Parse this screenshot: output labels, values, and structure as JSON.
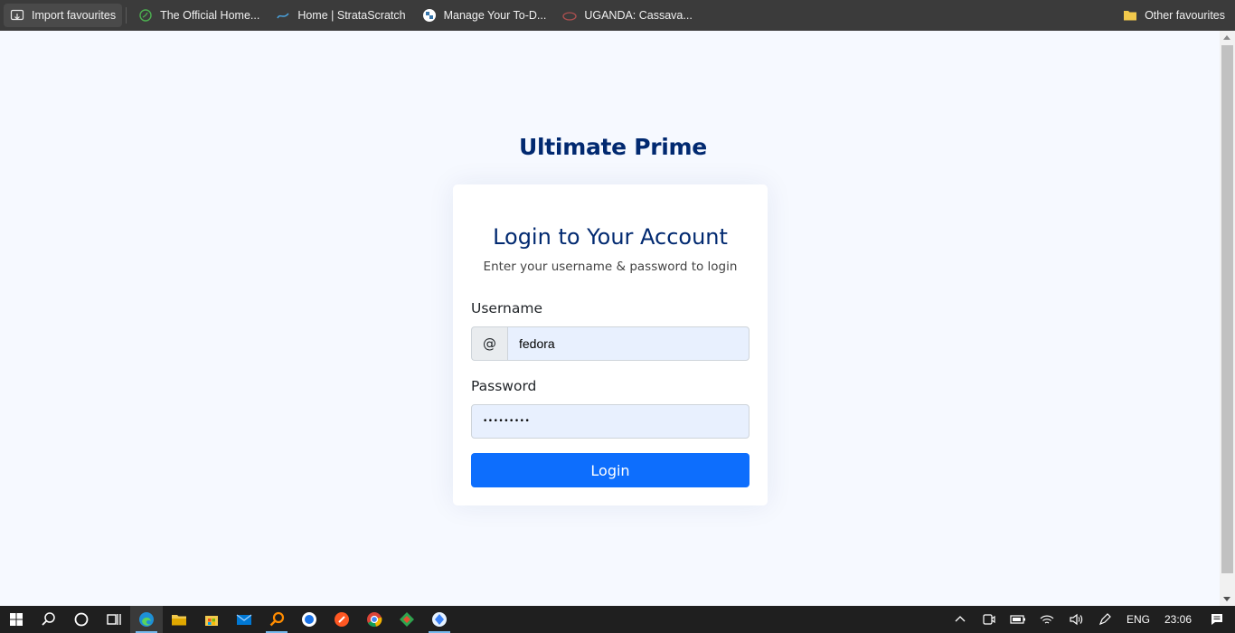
{
  "bookmarks": {
    "items": [
      {
        "label": "Import favourites",
        "icon": "import-favourites-icon"
      },
      {
        "label": "The Official Home...",
        "icon": "leaf-icon"
      },
      {
        "label": "Home | StrataScratch",
        "icon": "stratascratch-icon"
      },
      {
        "label": "Manage Your To-D...",
        "icon": "python-icon"
      },
      {
        "label": "UGANDA: Cassava...",
        "icon": "cassava-icon"
      }
    ],
    "other": {
      "label": "Other favourites",
      "icon": "folder-icon"
    }
  },
  "page": {
    "brand": "Ultimate Prime",
    "card": {
      "title": "Login to Your Account",
      "subtitle": "Enter your username & password to login",
      "username_label": "Username",
      "username_prefix": "@",
      "username_value": "fedora",
      "password_label": "Password",
      "password_value": "•••••••••",
      "login_label": "Login"
    }
  },
  "taskbar": {
    "apps": [
      "windows-start-icon",
      "search-icon",
      "cortana-icon",
      "task-view-icon",
      "edge-icon",
      "file-explorer-icon",
      "store-icon",
      "mail-icon",
      "search-app-icon",
      "app-blue-icon",
      "app-orange-icon",
      "chrome-icon",
      "git-icon",
      "app-diamond-icon"
    ],
    "language": "ENG",
    "time": "23:06"
  },
  "colors": {
    "brand": "#012970",
    "primary": "#0d6efd",
    "page_bg": "#f6f9ff",
    "autofill_bg": "#e8f0fe"
  }
}
